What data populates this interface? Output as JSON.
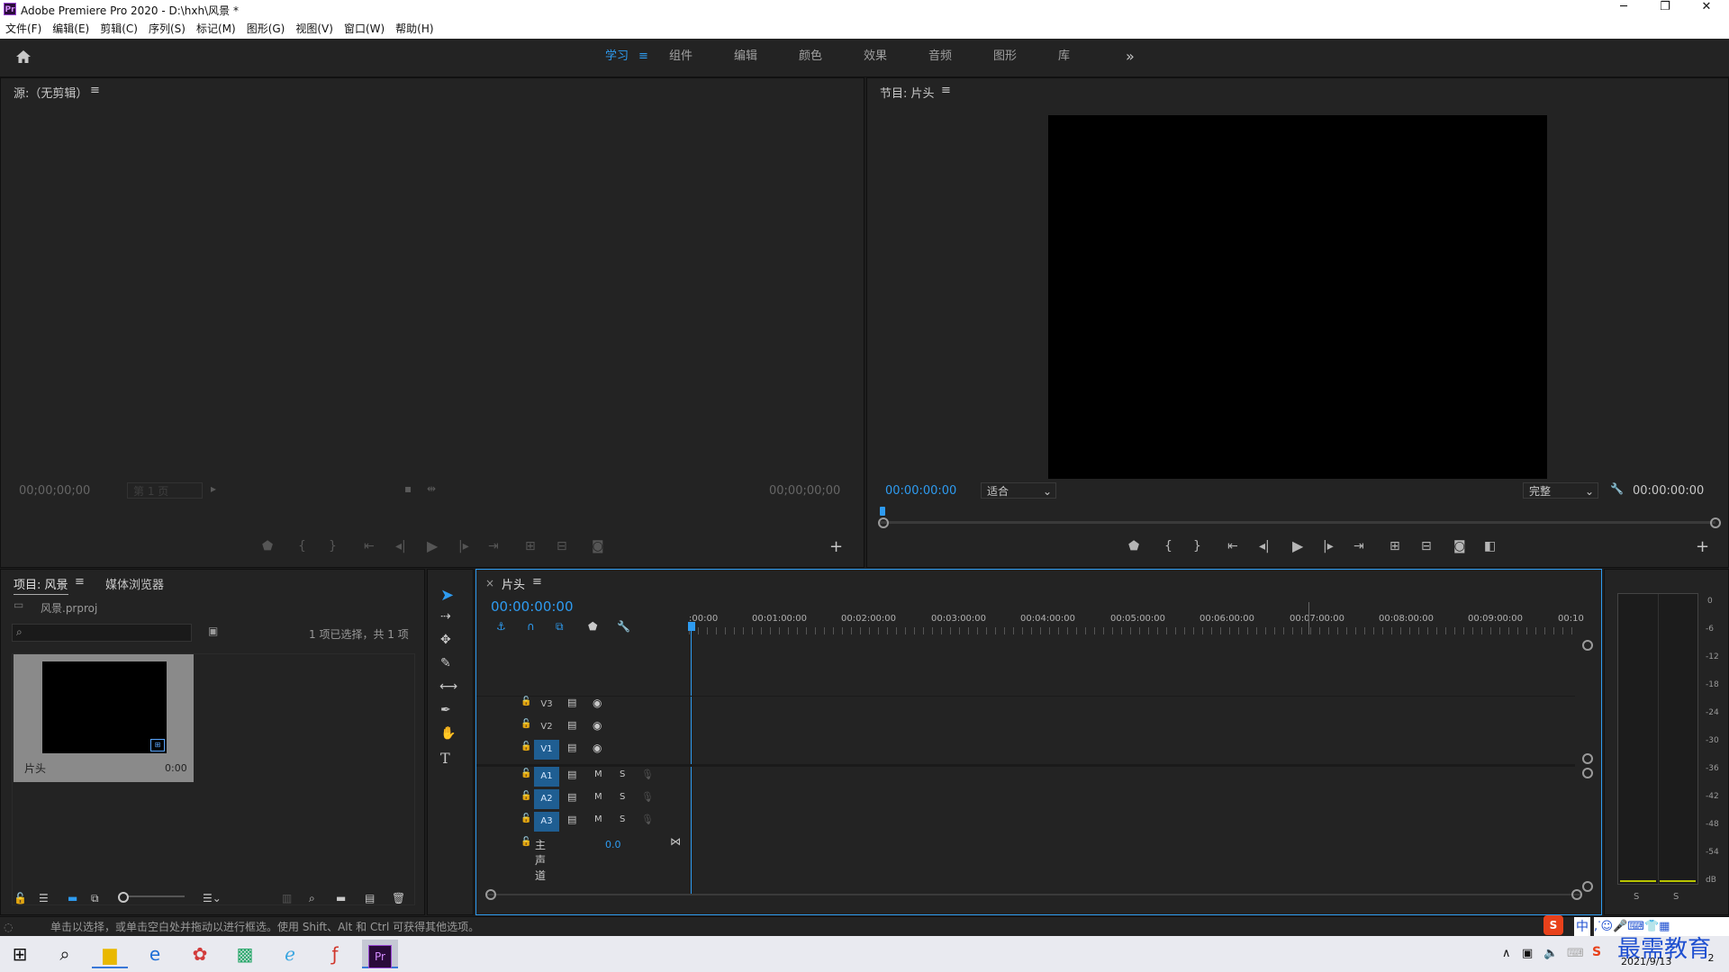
{
  "window": {
    "app_icon": "Pr",
    "title": "Adobe Premiere Pro 2020 - D:\\hxh\\风景 *",
    "minimize": "─",
    "restore": "❐",
    "close": "✕"
  },
  "menu": [
    "文件(F)",
    "编辑(E)",
    "剪辑(C)",
    "序列(S)",
    "标记(M)",
    "图形(G)",
    "视图(V)",
    "窗口(W)",
    "帮助(H)"
  ],
  "workspaces": {
    "items": [
      "学习",
      "组件",
      "编辑",
      "颜色",
      "效果",
      "音频",
      "图形",
      "库"
    ],
    "active_menu": "≡",
    "more": "»"
  },
  "source": {
    "title": "源:（无剪辑）",
    "menu": "≡",
    "timecode_left": "00;00;00;00",
    "page": "第 1 页",
    "timecode_right": "00;00;00;00"
  },
  "program": {
    "title": "节目: 片头",
    "menu": "≡",
    "timecode": "00:00:00:00",
    "fit": "适合",
    "quality": "完整",
    "duration": "00:00:00:00"
  },
  "project": {
    "tab1": "项目: 风景",
    "tab1_menu": "≡",
    "tab2": "媒体浏览器",
    "file": "风景.prproj",
    "selection": "1 项已选择，共 1 项",
    "search_placeholder": "",
    "item_name": "片头",
    "item_duration": "0:00"
  },
  "timeline": {
    "close": "×",
    "title": "片头",
    "menu": "≡",
    "timecode": "00:00:00:00",
    "ruler": [
      ":00:00",
      "00:01:00:00",
      "00:02:00:00",
      "00:03:00:00",
      "00:04:00:00",
      "00:05:00:00",
      "00:06:00:00",
      "00:07:00:00",
      "00:08:00:00",
      "00:09:00:00",
      "00:10"
    ],
    "video_tracks": [
      "V3",
      "V2",
      "V1"
    ],
    "audio_tracks": [
      "A1",
      "A2",
      "A3"
    ],
    "mute": "M",
    "solo": "S",
    "master": "主声道",
    "master_value": "0.0"
  },
  "meter": {
    "scale": [
      "0",
      "-6",
      "-12",
      "-18",
      "-24",
      "-30",
      "-36",
      "-42",
      "-48",
      "-54",
      "dB"
    ],
    "solo_left": "S",
    "solo_right": "S"
  },
  "status_text": "单击以选择，或单击空白处并拖动以进行框选。使用 Shift、Alt 和 Ctrl 可获得其他选项。",
  "tray": {
    "ime": "中",
    "date": "2021/9/13",
    "watermark": "最需教育",
    "badge": "2"
  }
}
